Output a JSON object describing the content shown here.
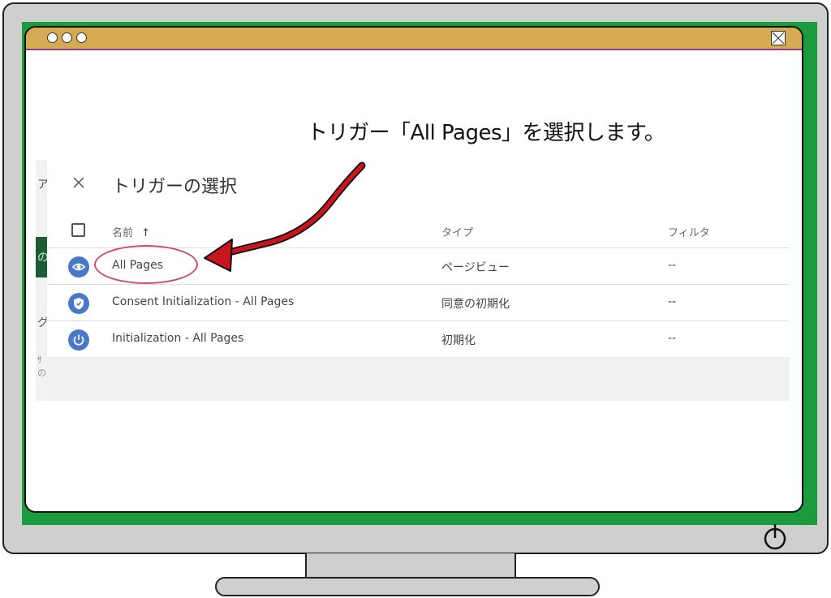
{
  "annotation": {
    "text": "トリガー「All Pages」を選択します。"
  },
  "background_page": {
    "fragments": [
      "ア",
      "の",
      "グ",
      "ｻの"
    ]
  },
  "dialog": {
    "title": "トリガーの選択",
    "columns": {
      "name": "名前",
      "sort_indicator": "↑",
      "type": "タイプ",
      "filter": "フィルタ"
    },
    "rows": [
      {
        "icon": "eye-icon",
        "name": "All Pages",
        "type": "ページビュー",
        "filter": "--"
      },
      {
        "icon": "shield-icon",
        "name": "Consent Initialization - All Pages",
        "type": "同意の初期化",
        "filter": "--"
      },
      {
        "icon": "power-icon",
        "name": "Initialization - All Pages",
        "type": "初期化",
        "filter": "--"
      }
    ]
  },
  "colors": {
    "bezel": "#1a9c3e",
    "titlebar": "#d4aa52",
    "arrow": "#c8161d",
    "highlight": "#cf4a6e",
    "row_icon": "#4a78c9"
  }
}
